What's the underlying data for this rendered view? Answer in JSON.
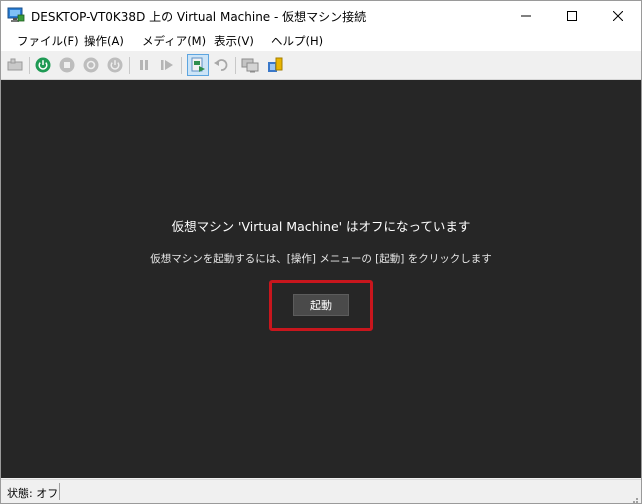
{
  "window": {
    "title": "DESKTOP-VT0K38D 上の Virtual Machine - 仮想マシン接続",
    "icon": "vm-connect-monitor-icon"
  },
  "menu": {
    "file": "ファイル(F)",
    "action": "操作(A)",
    "media": "メディア(M)",
    "view": "表示(V)",
    "help": "ヘルプ(H)"
  },
  "toolbar": {
    "icons": [
      "ctrl-alt-del-icon",
      "start-icon",
      "turn-off-icon",
      "shutdown-icon",
      "save-icon",
      "pause-icon",
      "resume-icon",
      "checkpoint-icon",
      "revert-icon",
      "enhanced-session-icon",
      "share-icon"
    ],
    "active": "checkpoint-icon"
  },
  "screen": {
    "title": "仮想マシン 'Virtual Machine' はオフになっています",
    "instruction": "仮想マシンを起動するには、[操作] メニューの [起動] をクリックします",
    "start_label": "起動",
    "highlight_color": "#c8161d"
  },
  "status": {
    "text": "状態: オフ"
  }
}
